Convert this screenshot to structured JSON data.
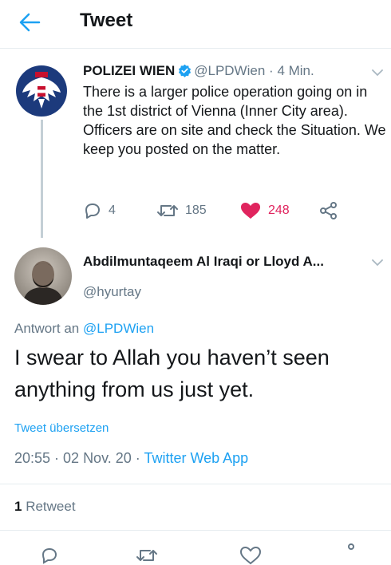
{
  "header": {
    "title": "Tweet"
  },
  "tweet": {
    "author_name": "POLIZEI WIEN",
    "handle": "@LPDWien",
    "separator": "·",
    "time": "4 Min.",
    "text": "There is a larger police operation going on in the 1st district of Vienna (Inner City area). Officers are on site and check the Situation. We keep you posted on the matter.",
    "replies": "4",
    "retweets": "185",
    "likes": "248"
  },
  "reply": {
    "author_name": "Abdilmuntaqeem Al Iraqi or Lloyd A...",
    "handle": "@hyurtay",
    "reply_to_prefix": "Antwort an",
    "reply_to_handle": "@LPDWien",
    "text": "I swear to Allah you haven’t seen anything from us just yet.",
    "translate": "Tweet übersetzen",
    "time_date": "20:55 · 02 Nov. 20 · ",
    "app": "Twitter Web App",
    "retweet_count": "1",
    "retweet_label": "Retweet"
  },
  "colors": {
    "accent": "#1da1f2",
    "like": "#e0245e",
    "muted": "#657786",
    "text": "#14171a"
  }
}
